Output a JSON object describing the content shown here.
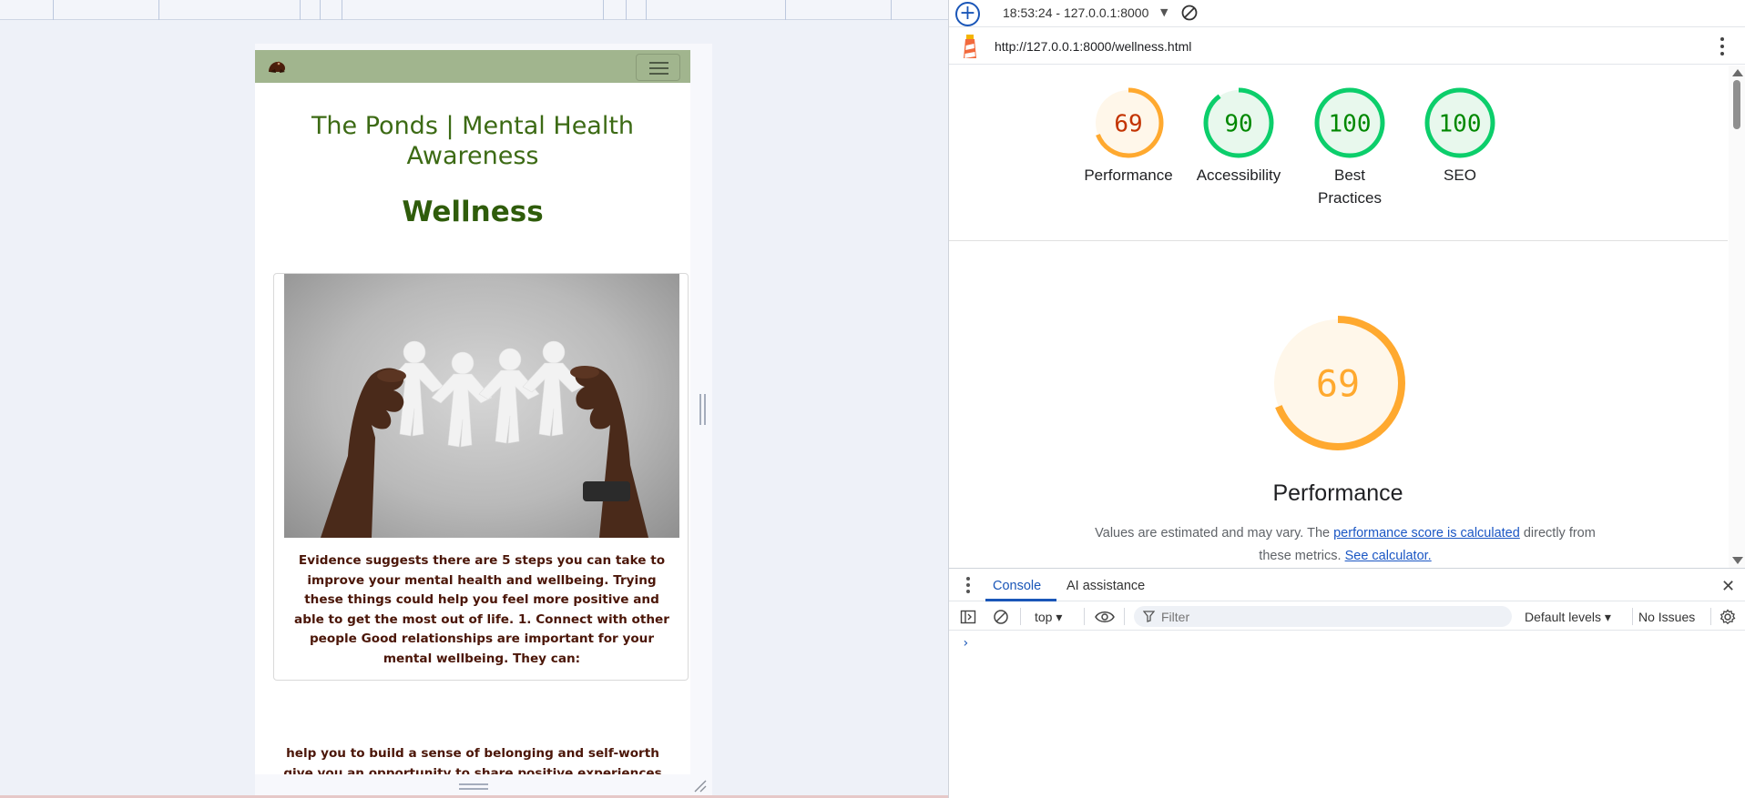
{
  "devtools": {
    "report_select": "18:53:24 - 127.0.0.1:8000",
    "report_url": "http://127.0.0.1:8000/wellness.html",
    "scores": [
      {
        "label": "Performance",
        "score": "69",
        "value": 69,
        "color": "#ffa92f",
        "text_color": "#c33300",
        "fill": "#fff7ea"
      },
      {
        "label": "Accessibility",
        "score": "90",
        "value": 90,
        "color": "#0cce6b",
        "text_color": "#008800",
        "fill": "#e8f8ed"
      },
      {
        "label": "Best Practices",
        "score": "100",
        "value": 100,
        "color": "#0cce6b",
        "text_color": "#008800",
        "fill": "#e8f8ed"
      },
      {
        "label": "SEO",
        "score": "100",
        "value": 100,
        "color": "#0cce6b",
        "text_color": "#008800",
        "fill": "#e8f8ed"
      }
    ],
    "performance_section": {
      "score": "69",
      "value": 69,
      "title": "Performance",
      "desc_prefix": "Values are estimated and may vary. The ",
      "desc_link1": "performance score is calculated",
      "desc_middle": " directly from these metrics. ",
      "desc_link2": "See calculator."
    },
    "drawer": {
      "tabs": [
        "Console",
        "AI assistance"
      ],
      "context": "top",
      "filter_placeholder": "Filter",
      "levels": "Default levels",
      "issues": "No Issues",
      "prompt": "›"
    }
  },
  "website": {
    "title": "The Ponds | Mental Health Awareness",
    "heading": "Wellness",
    "card_text": "Evidence suggests there are 5 steps you can take to improve your mental health and wellbeing. Trying these things could help you feel more positive and able to get the most out of life. 1. Connect with other people Good relationships are important for your mental wellbeing. They can:",
    "below_text": "help you to build a sense of belonging and self-worth give you an opportunity to share positive experiences provide",
    "image_alt": "hands holding paper people chain"
  },
  "colors": {
    "nav_bg": "#a1b58e",
    "title_color": "#3c6a14",
    "body_text": "#4b1608",
    "accent_blue": "#1a56b8"
  }
}
